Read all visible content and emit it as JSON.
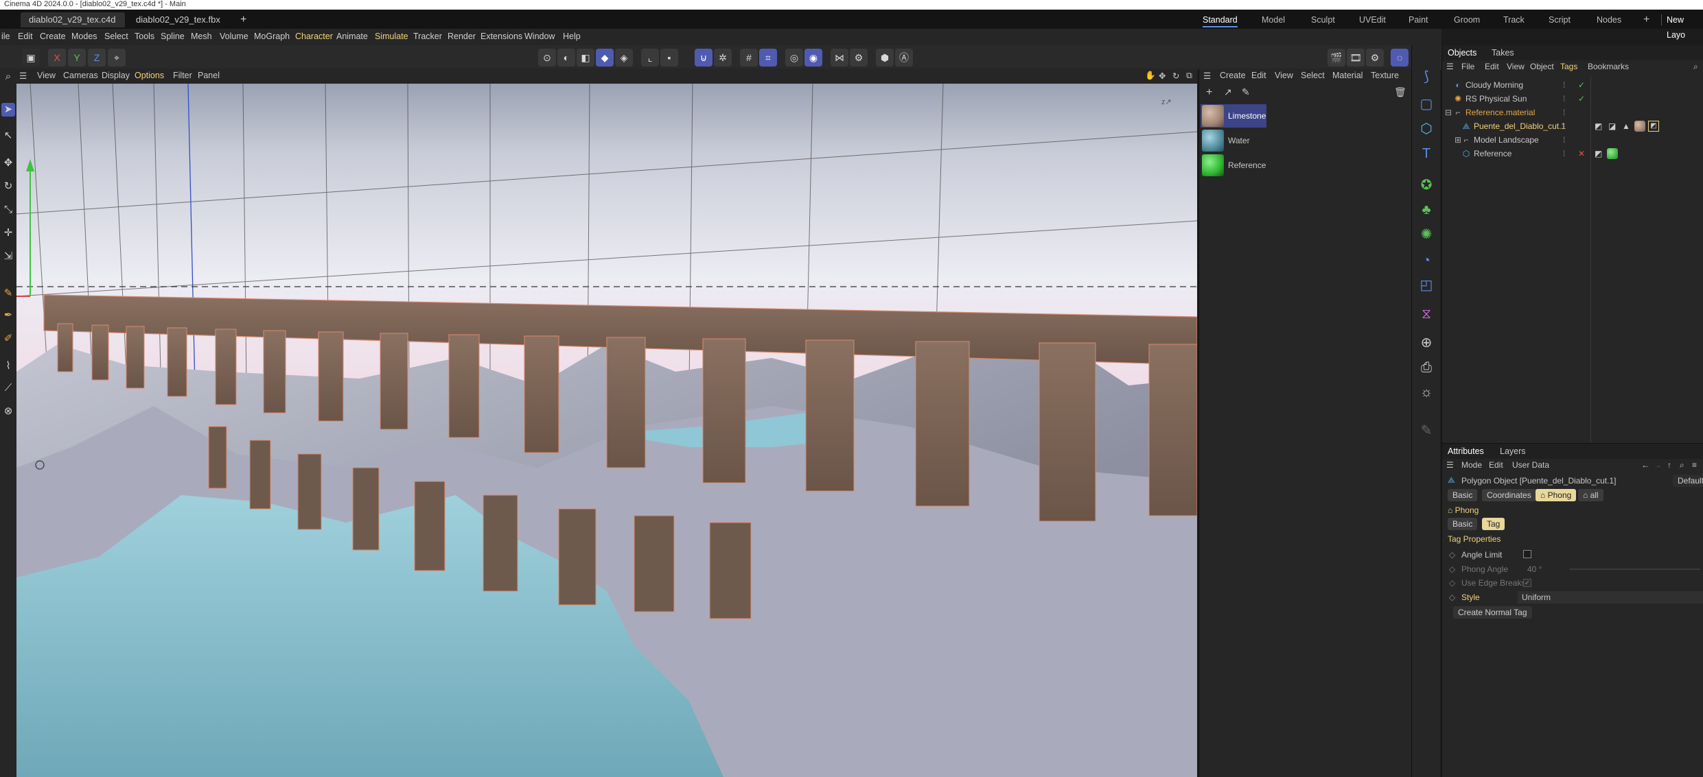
{
  "window_title": "Cinema 4D 2024.0.0 - [diablo02_v29_tex.c4d *] - Main",
  "tabs": [
    {
      "label": "diablo02_v29_tex.c4d *"
    },
    {
      "label": "diablo02_v29_tex.fbx *"
    }
  ],
  "new_tab_glyph": "+",
  "layouts": [
    "Standard",
    "Model",
    "Sculpt",
    "UVEdit",
    "Paint",
    "Groom",
    "Track",
    "Script",
    "Nodes"
  ],
  "new_layout_label": "New Layo",
  "menu": [
    "ile",
    "Edit",
    "Create",
    "Modes",
    "Select",
    "Tools",
    "Spline",
    "Mesh",
    "Volume",
    "MoGraph",
    "Character",
    "Animate",
    "Simulate",
    "Tracker",
    "Render",
    "Extensions",
    "Window",
    "Help"
  ],
  "axes": {
    "x": "X",
    "y": "Y",
    "z": "Z"
  },
  "viewport_menu": [
    "View",
    "Cameras",
    "Display",
    "Options",
    "Filter",
    "Panel"
  ],
  "material_menu": [
    "Create",
    "Edit",
    "View",
    "Select",
    "Material",
    "Texture"
  ],
  "materials": [
    {
      "name": "Limestone",
      "color": "#a08573"
    },
    {
      "name": "Water",
      "color": "#4f8a9a"
    },
    {
      "name": "Reference",
      "color": "#2fb52f"
    }
  ],
  "objects_panel": {
    "tabs": [
      "Objects",
      "Takes"
    ],
    "menu": [
      "File",
      "Edit",
      "View",
      "Object",
      "Tags",
      "Bookmarks"
    ],
    "items": [
      {
        "name": "Cloudy Morning",
        "icon": "sky-icon"
      },
      {
        "name": "RS Physical Sun",
        "icon": "sun-icon"
      },
      {
        "name": "Reference.material",
        "icon": "null-icon"
      },
      {
        "name": "Puente_del_Diablo_cut.1",
        "icon": "polygon-icon"
      },
      {
        "name": "Model Landscape",
        "icon": "null-icon"
      },
      {
        "name": "Reference",
        "icon": "polygon-icon"
      }
    ]
  },
  "attributes_panel": {
    "tabs": [
      "Attributes",
      "Layers"
    ],
    "menu": [
      "Mode",
      "Edit",
      "User Data"
    ],
    "object_title": "Polygon Object [Puente_del_Diablo_cut.1]",
    "default_label": "Default",
    "object_tabs": [
      "Basic",
      "Coordinates",
      "Phong",
      "all"
    ],
    "section_title": "Phong",
    "section_tabs": [
      "Basic",
      "Tag"
    ],
    "group_title": "Tag Properties",
    "fields": {
      "angle_limit_label": "Angle Limit",
      "phong_angle_label": "Phong Angle",
      "phong_angle_value": "40 °",
      "edge_breaks_label": "Use Edge Breaks",
      "style_label": "Style",
      "style_value": "Uniform"
    },
    "create_normal_tag_label": "Create Normal Tag"
  },
  "colors": {
    "accent": "#5b8de8",
    "selection": "#3d4488",
    "highlight_text": "#f2d27a",
    "pill_active": "#e8d89a"
  }
}
